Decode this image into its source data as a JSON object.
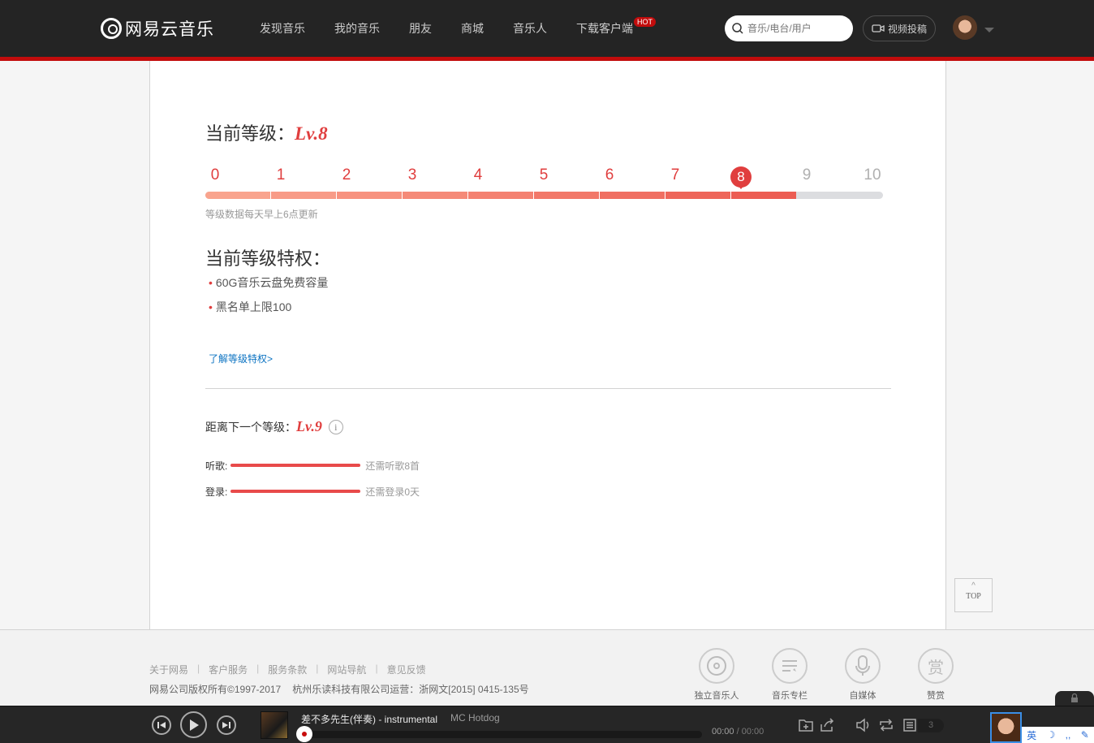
{
  "header": {
    "logo_text": "网易云音乐",
    "nav": [
      {
        "label": "发现音乐"
      },
      {
        "label": "我的音乐"
      },
      {
        "label": "朋友"
      },
      {
        "label": "商城"
      },
      {
        "label": "音乐人"
      },
      {
        "label": "下载客户端",
        "badge": "HOT"
      }
    ],
    "search_placeholder": "音乐/电台/用户",
    "video_button": "视频投稿"
  },
  "level": {
    "current_title": "当前等级：",
    "current_level": "Lv.8",
    "current_level_number": 8,
    "ticks": [
      "0",
      "1",
      "2",
      "3",
      "4",
      "5",
      "6",
      "7",
      "8",
      "9",
      "10"
    ],
    "update_note": "等级数据每天早上6点更新",
    "privileges_title": "当前等级特权：",
    "privileges": [
      "60G音乐云盘免费容量",
      "黑名单上限100"
    ],
    "learn_more": "了解等级特权>",
    "next_title": "距离下一个等级：",
    "next_level": "Lv.9",
    "info_icon_glyph": "i",
    "requirements": [
      {
        "label": "听歌:",
        "progress": 1.0,
        "text": "还需听歌8首"
      },
      {
        "label": "登录:",
        "progress": 1.0,
        "text": "还需登录0天"
      }
    ],
    "colors": {
      "accent": "#e03e3e",
      "track": "#dcdde0"
    }
  },
  "top_button": {
    "arrow": "^",
    "label": "TOP"
  },
  "footer": {
    "links": [
      "关于网易",
      "客户服务",
      "服务条款",
      "网站导航",
      "意见反馈"
    ],
    "copyright": "网易公司版权所有©1997-2017",
    "operator": "杭州乐读科技有限公司运营：浙网文[2015] 0415-135号",
    "icons": [
      {
        "label": "独立音乐人",
        "icon": "disc-icon"
      },
      {
        "label": "音乐专栏",
        "icon": "column-icon"
      },
      {
        "label": "自媒体",
        "icon": "microphone-icon"
      },
      {
        "label": "赞赏",
        "icon": "reward-icon"
      }
    ],
    "reward_glyph": "赏"
  },
  "player": {
    "song_title": "差不多先生(伴奏) - instrumental",
    "artist": "MC Hotdog",
    "time_current": "00:00",
    "time_total": "/ 00:00",
    "playlist_count": "3"
  },
  "ime": {
    "lang": "英"
  }
}
